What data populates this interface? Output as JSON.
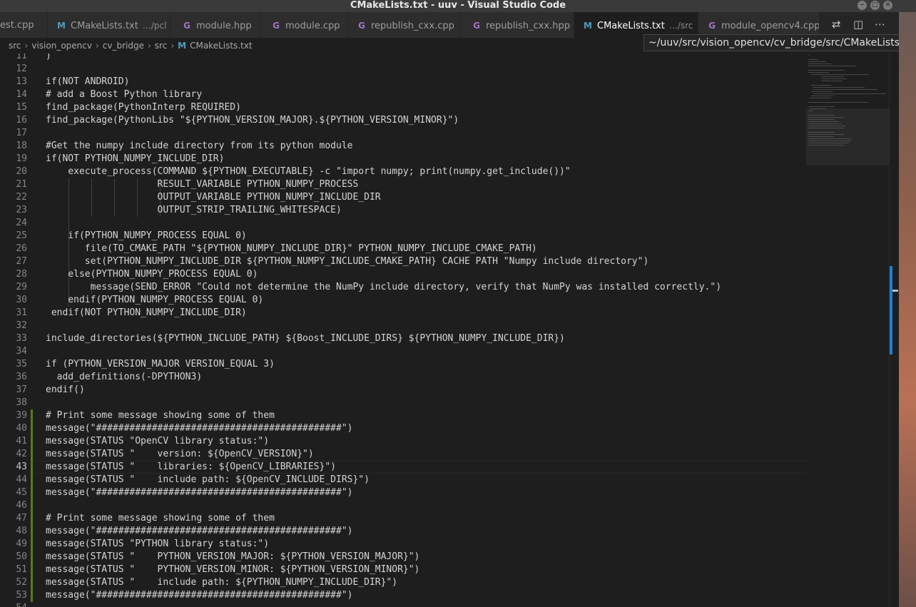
{
  "window": {
    "title": "CMakeLists.txt - uuv - Visual Studio Code"
  },
  "tabs": [
    {
      "label": "est.cpp",
      "icon": "cpp-file-icon",
      "desc": "",
      "active": false
    },
    {
      "label": "CMakeLists.txt",
      "icon": "cmake-file-icon",
      "desc": "…/pcl",
      "active": false
    },
    {
      "label": "module.hpp",
      "icon": "cpp-file-icon",
      "desc": "",
      "active": false
    },
    {
      "label": "module.cpp",
      "icon": "cpp-file-icon",
      "desc": "",
      "active": false
    },
    {
      "label": "republish_cxx.cpp",
      "icon": "cpp-file-icon",
      "desc": "",
      "active": false
    },
    {
      "label": "republish_cxx.hpp",
      "icon": "cpp-file-icon",
      "desc": "",
      "active": false
    },
    {
      "label": "CMakeLists.txt",
      "icon": "cmake-file-icon",
      "desc": "…/src",
      "active": true
    },
    {
      "label": "module_opencv4.cpp",
      "icon": "cpp-file-icon",
      "desc": "",
      "active": false
    }
  ],
  "tooltip": "~/uuv/src/vision_opencv/cv_bridge/src/CMakeLists.txt",
  "breadcrumbs": [
    "src",
    "vision_opencv",
    "cv_bridge",
    "src",
    "CMakeLists.txt"
  ],
  "colors": {
    "accent": "#1b81d4",
    "modified_gutter": "#587c0c",
    "editor_bg": "#1e1e1e",
    "text": "#d4d4d4"
  },
  "editor": {
    "current_line": 43,
    "lines": [
      {
        "n": "11",
        "text": ")",
        "mod": false,
        "indent": 0
      },
      {
        "n": "12",
        "text": "",
        "mod": false,
        "indent": 0
      },
      {
        "n": "13",
        "text": "if(NOT ANDROID)",
        "mod": false,
        "indent": 0
      },
      {
        "n": "14",
        "text": "# add a Boost Python library",
        "mod": false,
        "indent": 0
      },
      {
        "n": "15",
        "text": "find_package(PythonInterp REQUIRED)",
        "mod": false,
        "indent": 0
      },
      {
        "n": "16",
        "text": "find_package(PythonLibs \"${PYTHON_VERSION_MAJOR}.${PYTHON_VERSION_MINOR}\")",
        "mod": false,
        "indent": 0
      },
      {
        "n": "17",
        "text": "",
        "mod": false,
        "indent": 0
      },
      {
        "n": "18",
        "text": "#Get the numpy include directory from its python module",
        "mod": false,
        "indent": 0
      },
      {
        "n": "19",
        "text": "if(NOT PYTHON_NUMPY_INCLUDE_DIR)",
        "mod": false,
        "indent": 0
      },
      {
        "n": "20",
        "text": "    execute_process(COMMAND ${PYTHON_EXECUTABLE} -c \"import numpy; print(numpy.get_include())\"",
        "mod": false,
        "indent": 0
      },
      {
        "n": "21",
        "text": "                    RESULT_VARIABLE PYTHON_NUMPY_PROCESS",
        "mod": false,
        "indent": 5
      },
      {
        "n": "22",
        "text": "                    OUTPUT_VARIABLE PYTHON_NUMPY_INCLUDE_DIR",
        "mod": false,
        "indent": 5
      },
      {
        "n": "23",
        "text": "                    OUTPUT_STRIP_TRAILING_WHITESPACE)",
        "mod": false,
        "indent": 5
      },
      {
        "n": "24",
        "text": "",
        "mod": false,
        "indent": 1
      },
      {
        "n": "25",
        "text": "    if(PYTHON_NUMPY_PROCESS EQUAL 0)",
        "mod": false,
        "indent": 1
      },
      {
        "n": "26",
        "text": "       file(TO_CMAKE_PATH \"${PYTHON_NUMPY_INCLUDE_DIR}\" PYTHON_NUMPY_INCLUDE_CMAKE_PATH)",
        "mod": false,
        "indent": 1
      },
      {
        "n": "27",
        "text": "       set(PYTHON_NUMPY_INCLUDE_DIR ${PYTHON_NUMPY_INCLUDE_CMAKE_PATH} CACHE PATH \"Numpy include directory\")",
        "mod": false,
        "indent": 1
      },
      {
        "n": "28",
        "text": "    else(PYTHON_NUMPY_PROCESS EQUAL 0)",
        "mod": false,
        "indent": 1
      },
      {
        "n": "29",
        "text": "        message(SEND_ERROR \"Could not determine the NumPy include directory, verify that NumPy was installed correctly.\")",
        "mod": false,
        "indent": 2
      },
      {
        "n": "30",
        "text": "    endif(PYTHON_NUMPY_PROCESS EQUAL 0)",
        "mod": false,
        "indent": 1
      },
      {
        "n": "31",
        "text": " endif(NOT PYTHON_NUMPY_INCLUDE_DIR)",
        "mod": false,
        "indent": 0
      },
      {
        "n": "32",
        "text": "",
        "mod": false,
        "indent": 0
      },
      {
        "n": "33",
        "text": "include_directories(${PYTHON_INCLUDE_PATH} ${Boost_INCLUDE_DIRS} ${PYTHON_NUMPY_INCLUDE_DIR})",
        "mod": false,
        "indent": 0
      },
      {
        "n": "34",
        "text": "",
        "mod": false,
        "indent": 0
      },
      {
        "n": "35",
        "text": "if (PYTHON_VERSION_MAJOR VERSION_EQUAL 3)",
        "mod": false,
        "indent": 0
      },
      {
        "n": "36",
        "text": "  add_definitions(-DPYTHON3)",
        "mod": false,
        "indent": 0
      },
      {
        "n": "37",
        "text": "endif()",
        "mod": false,
        "indent": 0
      },
      {
        "n": "38",
        "text": "",
        "mod": false,
        "indent": 0
      },
      {
        "n": "39",
        "text": "# Print some message showing some of them",
        "mod": true,
        "indent": 0
      },
      {
        "n": "40",
        "text": "message(\"############################################\")",
        "mod": true,
        "indent": 0
      },
      {
        "n": "41",
        "text": "message(STATUS \"OpenCV library status:\")",
        "mod": true,
        "indent": 0
      },
      {
        "n": "42",
        "text": "message(STATUS \"    version: ${OpenCV_VERSION}\")",
        "mod": true,
        "indent": 0
      },
      {
        "n": "43",
        "text": "message(STATUS \"    libraries: ${OpenCV_LIBRARIES}\")",
        "mod": true,
        "indent": 0
      },
      {
        "n": "44",
        "text": "message(STATUS \"    include path: ${OpenCV_INCLUDE_DIRS}\")",
        "mod": true,
        "indent": 0
      },
      {
        "n": "45",
        "text": "message(\"############################################\")",
        "mod": true,
        "indent": 0
      },
      {
        "n": "46",
        "text": "",
        "mod": true,
        "indent": 0
      },
      {
        "n": "47",
        "text": "# Print some message showing some of them",
        "mod": true,
        "indent": 0
      },
      {
        "n": "48",
        "text": "message(\"############################################\")",
        "mod": true,
        "indent": 0
      },
      {
        "n": "49",
        "text": "message(STATUS \"PYTHON library status:\")",
        "mod": true,
        "indent": 0
      },
      {
        "n": "50",
        "text": "message(STATUS \"    PYTHON_VERSION_MAJOR: ${PYTHON_VERSION_MAJOR}\")",
        "mod": true,
        "indent": 0
      },
      {
        "n": "51",
        "text": "message(STATUS \"    PYTHON_VERSION_MINOR: ${PYTHON_VERSION_MINOR}\")",
        "mod": true,
        "indent": 0
      },
      {
        "n": "52",
        "text": "message(STATUS \"    include path: ${PYTHON_NUMPY_INCLUDE_DIR}\")",
        "mod": true,
        "indent": 0
      },
      {
        "n": "53",
        "text": "message(\"############################################\")",
        "mod": true,
        "indent": 0
      },
      {
        "n": "54",
        "text": "",
        "mod": false,
        "indent": 0
      }
    ]
  }
}
